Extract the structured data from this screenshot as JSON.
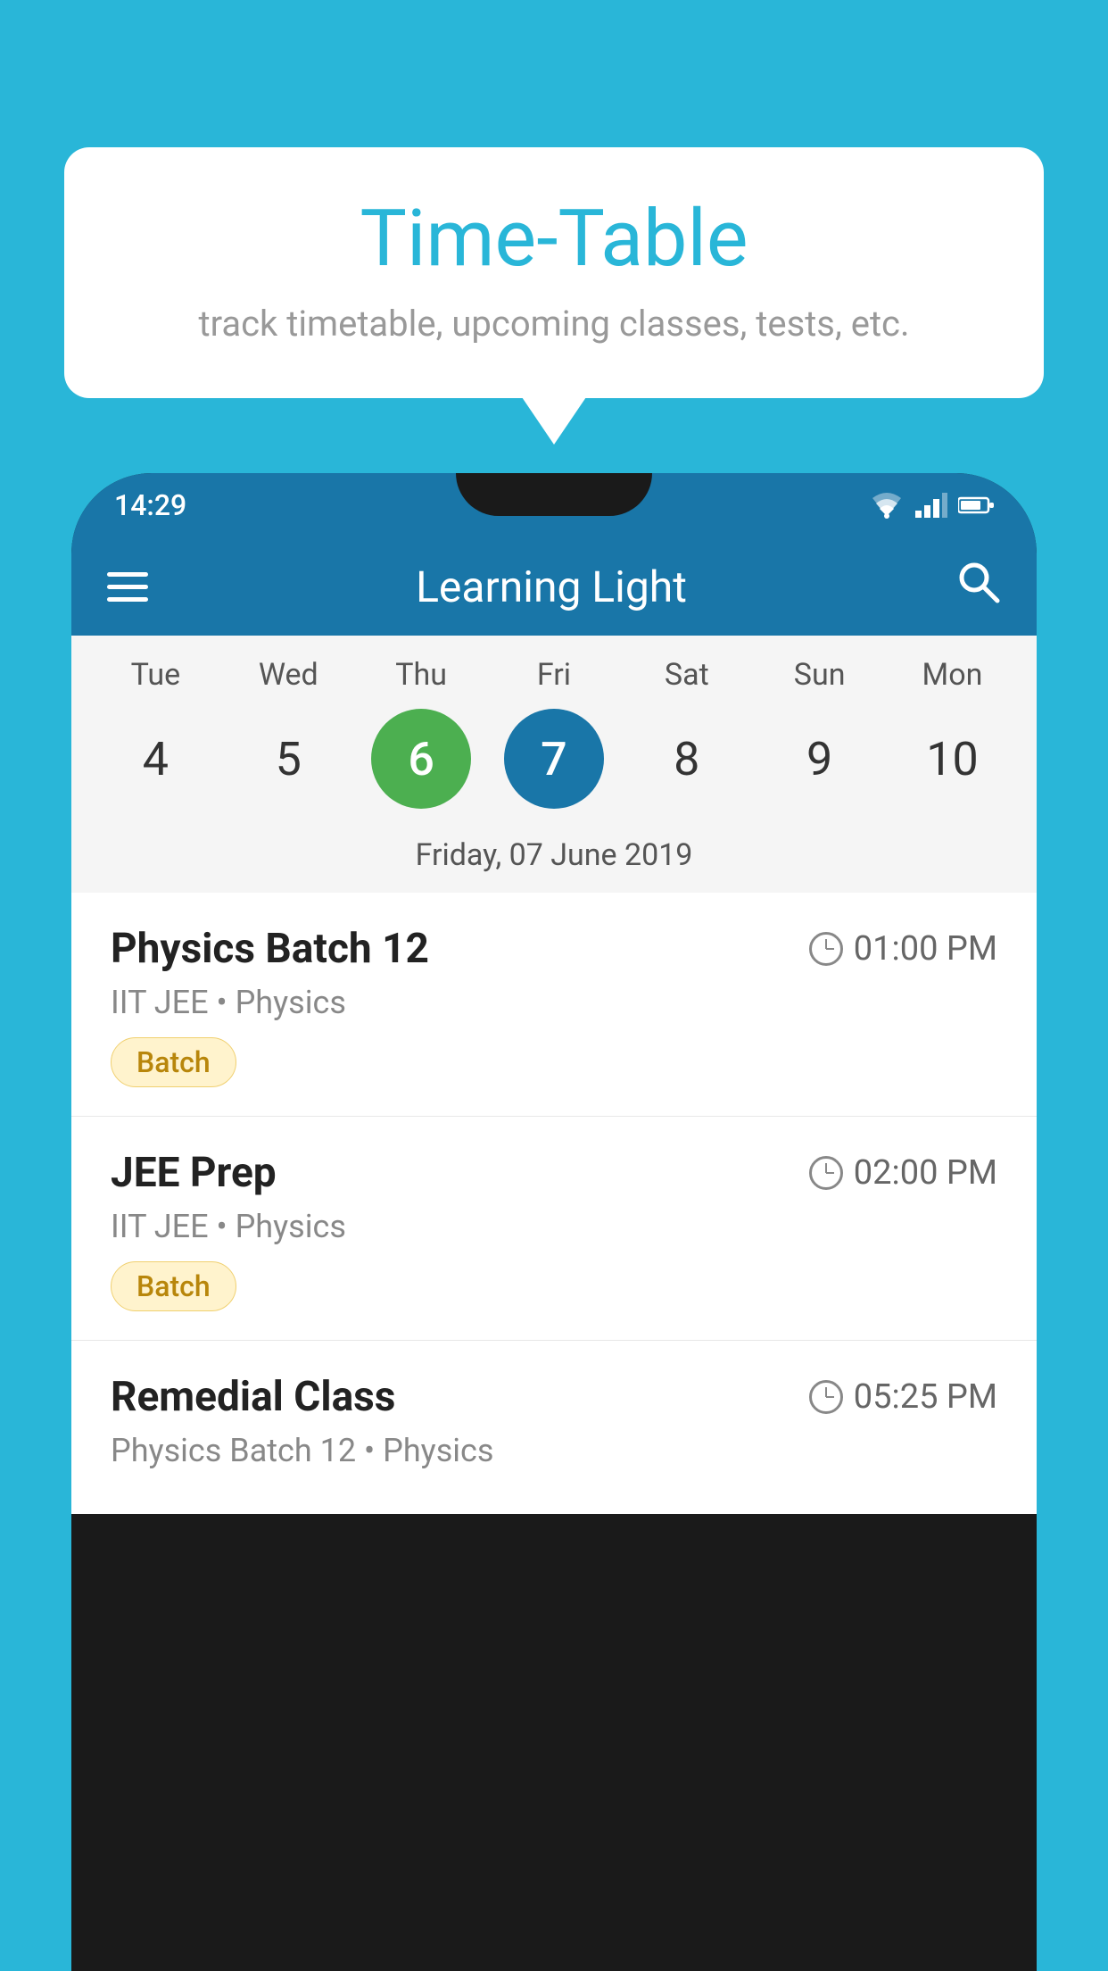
{
  "background_color": "#29b6d8",
  "speech_bubble": {
    "title": "Time-Table",
    "subtitle": "track timetable, upcoming classes, tests, etc."
  },
  "status_bar": {
    "time": "14:29"
  },
  "toolbar": {
    "title": "Learning Light",
    "menu_label": "menu",
    "search_label": "search"
  },
  "calendar": {
    "days": [
      {
        "short": "Tue",
        "num": "4"
      },
      {
        "short": "Wed",
        "num": "5"
      },
      {
        "short": "Thu",
        "num": "6",
        "state": "today"
      },
      {
        "short": "Fri",
        "num": "7",
        "state": "selected"
      },
      {
        "short": "Sat",
        "num": "8"
      },
      {
        "short": "Sun",
        "num": "9"
      },
      {
        "short": "Mon",
        "num": "10"
      }
    ],
    "selected_date_label": "Friday, 07 June 2019"
  },
  "schedule": {
    "items": [
      {
        "title": "Physics Batch 12",
        "time": "01:00 PM",
        "sub": "IIT JEE • Physics",
        "badge": "Batch"
      },
      {
        "title": "JEE Prep",
        "time": "02:00 PM",
        "sub": "IIT JEE • Physics",
        "badge": "Batch"
      },
      {
        "title": "Remedial Class",
        "time": "05:25 PM",
        "sub": "Physics Batch 12 • Physics",
        "badge": null
      }
    ]
  }
}
